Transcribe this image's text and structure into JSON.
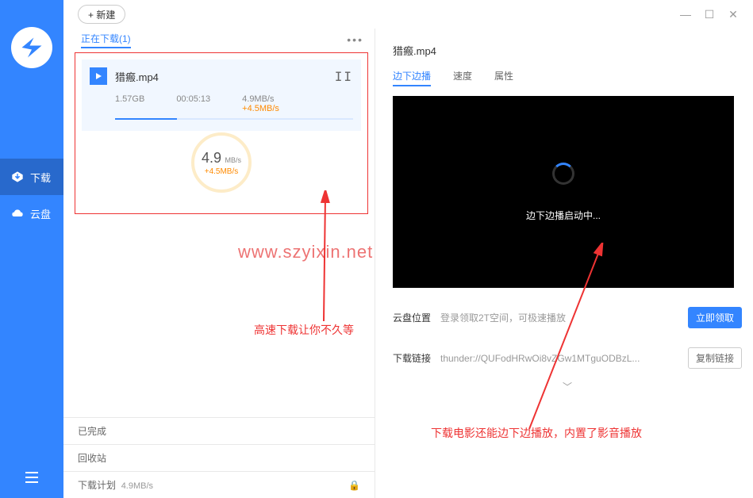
{
  "sidebar": {
    "nav_download": "下载",
    "nav_cloud": "云盘"
  },
  "topbar": {
    "new_label": "+ 新建"
  },
  "left": {
    "tab_downloading": "正在下载(1)",
    "task": {
      "name": "猎瘢.mp4",
      "size": "1.57GB",
      "time": "00:05:13",
      "speed": "4.9MB/s",
      "boost": "+4.5MB/s"
    },
    "badge": {
      "value": "4.9",
      "unit": "MB/s",
      "boost": "+4.5MB/s"
    },
    "bottom": {
      "done": "已完成",
      "recycle": "回收站",
      "plan": "下载计划",
      "plan_speed": "4.9MB/s"
    }
  },
  "right": {
    "filename": "猎瘢.mp4",
    "tab_play": "边下边播",
    "tab_speed": "速度",
    "tab_attr": "属性",
    "loading": "边下边播启动中...",
    "cloud_label": "云盘位置",
    "cloud_value": "登录领取2T空间，可极速播放",
    "cloud_btn": "立即领取",
    "link_label": "下载链接",
    "link_value": "thunder://QUFodHRwOi8vZGw1MTguODBzL...",
    "link_btn": "复制链接",
    "chevron": "﹀"
  },
  "annotations": {
    "a1": "高速下载让你不久等",
    "a2": "下载电影还能边下边播放，内置了影音播放",
    "watermark": "www.szyixin.net"
  }
}
